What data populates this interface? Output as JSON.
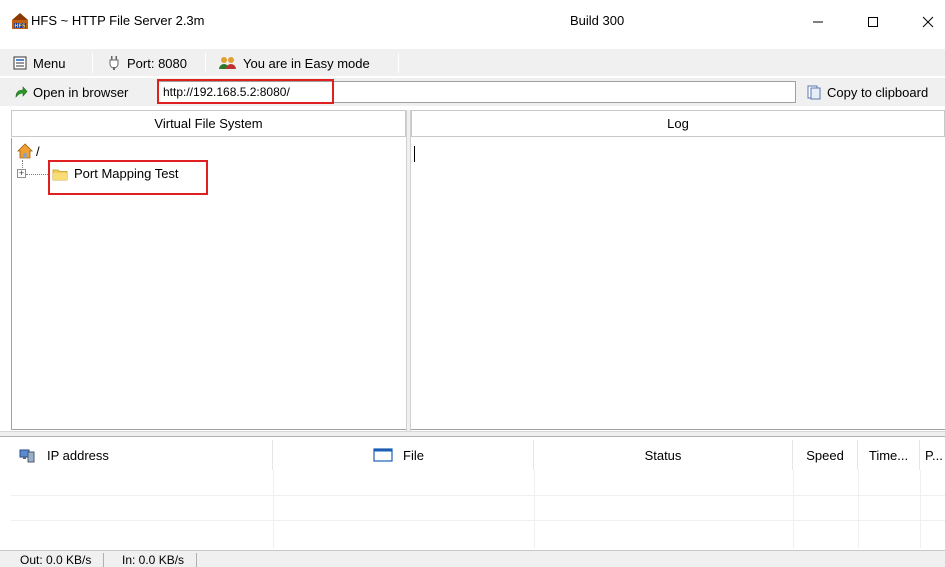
{
  "window": {
    "title": "HFS ~ HTTP File Server 2.3m",
    "build": "Build 300"
  },
  "menubar": {
    "menu_label": "Menu",
    "port_label": "Port: 8080",
    "mode_label": "You are in Easy mode"
  },
  "urlbar": {
    "open_label": "Open in browser",
    "url_value": "http://192.168.5.2:8080/",
    "copy_label": "Copy to clipboard"
  },
  "vfs": {
    "header": "Virtual File System",
    "root_label": "/",
    "items": [
      {
        "label": "Port Mapping Test"
      }
    ]
  },
  "log": {
    "header": "Log"
  },
  "connections": {
    "columns": [
      "IP address",
      "File",
      "Status",
      "Speed",
      "Time...",
      "P..."
    ]
  },
  "status": {
    "out": "Out: 0.0 KB/s",
    "in": "In: 0.0 KB/s"
  },
  "colors": {
    "highlight": "#e02020",
    "chrome": "#f0f0f0"
  }
}
